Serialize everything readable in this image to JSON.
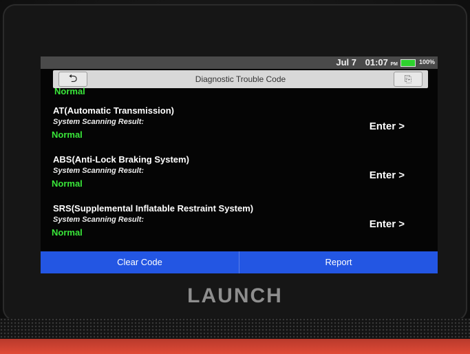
{
  "status_bar": {
    "date": "Jul 7",
    "time": "01:07",
    "meridiem": "PM",
    "battery": "100%"
  },
  "title_bar": {
    "title": "Diagnostic Trouble Code",
    "back_icon": "back-arrow-icon",
    "exit_icon": "exit-icon"
  },
  "list": {
    "partial_status": "Normal",
    "rows": [
      {
        "name": "AT(Automatic Transmission)",
        "label": "System Scanning Result:",
        "status": "Normal",
        "enter": "Enter >"
      },
      {
        "name": "ABS(Anti-Lock Braking System)",
        "label": "System Scanning Result:",
        "status": "Normal",
        "enter": "Enter >"
      },
      {
        "name": "SRS(Supplemental Inflatable Restraint System)",
        "label": "System Scanning Result:",
        "status": "Normal",
        "enter": "Enter >"
      }
    ]
  },
  "actions": {
    "clear_code": "Clear Code",
    "report": "Report"
  },
  "brand": "LAUNCH",
  "colors": {
    "status_normal": "#39e639",
    "action_bar": "#2356e3",
    "battery": "#2ed12e"
  }
}
